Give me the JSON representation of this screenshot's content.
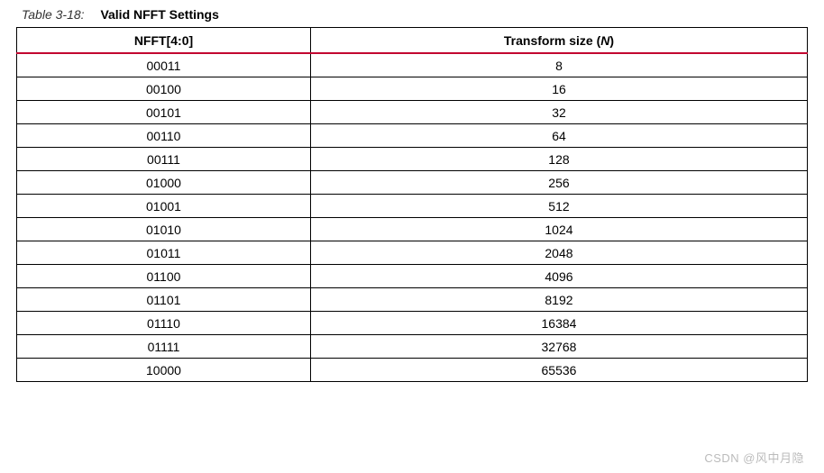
{
  "caption": {
    "label": "Table 3-18:",
    "title": "Valid NFFT Settings"
  },
  "headers": {
    "col1": "NFFT[4:0]",
    "col2_prefix": "Transform size (",
    "col2_var": "N",
    "col2_suffix": ")"
  },
  "rows": [
    {
      "nfft": "00011",
      "size": "8"
    },
    {
      "nfft": "00100",
      "size": "16"
    },
    {
      "nfft": "00101",
      "size": "32"
    },
    {
      "nfft": "00110",
      "size": "64"
    },
    {
      "nfft": "00111",
      "size": "128"
    },
    {
      "nfft": "01000",
      "size": "256"
    },
    {
      "nfft": "01001",
      "size": "512"
    },
    {
      "nfft": "01010",
      "size": "1024"
    },
    {
      "nfft": "01011",
      "size": "2048"
    },
    {
      "nfft": "01100",
      "size": "4096"
    },
    {
      "nfft": "01101",
      "size": "8192"
    },
    {
      "nfft": "01110",
      "size": "16384"
    },
    {
      "nfft": "01111",
      "size": "32768"
    },
    {
      "nfft": "10000",
      "size": "65536"
    }
  ],
  "watermark": "CSDN @风中月隐"
}
